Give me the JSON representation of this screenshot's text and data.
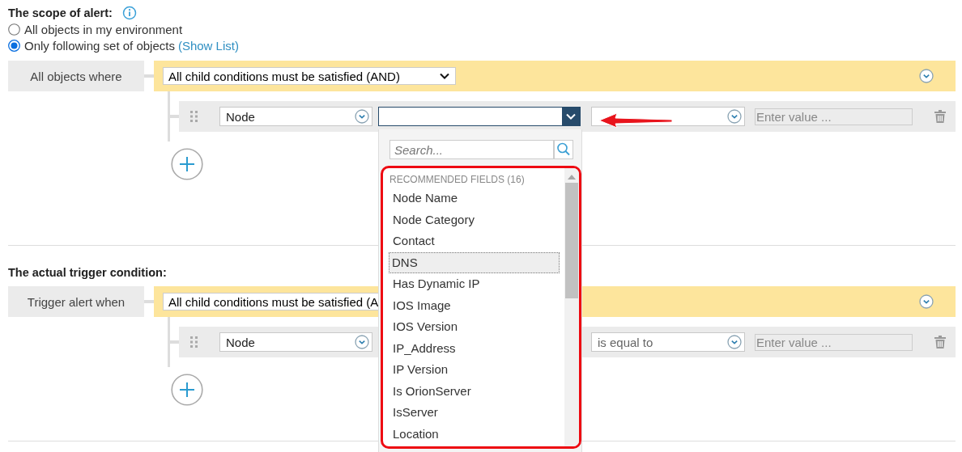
{
  "sections": [
    {
      "title": "The scope of alert:",
      "info": true,
      "options": [
        {
          "label": "All objects in my environment",
          "selected": false
        },
        {
          "label": "Only following set of objects",
          "link": "(Show List)",
          "selected": true
        }
      ],
      "block": {
        "label": "All objects where",
        "operator": "All child conditions must be satisfied (AND)",
        "caret": true,
        "collapse": true,
        "conditions": [
          {
            "object": "Node",
            "field": {
              "open": true
            },
            "value_placeholder": "Enter value ..."
          }
        ]
      }
    },
    {
      "title": "The actual trigger condition:",
      "info": false,
      "block": {
        "label": "Trigger alert when",
        "operator": "All child conditions must be satisfied (A",
        "caret": false,
        "collapse": true,
        "conditions": [
          {
            "object": "Node",
            "comparison": "is equal to",
            "value_placeholder": "Enter value ..."
          }
        ]
      }
    }
  ],
  "field_dropdown": {
    "search_placeholder": "Search...",
    "group": "RECOMMENDED FIELDS (16)",
    "items": [
      {
        "label": "Node Name",
        "selected": false
      },
      {
        "label": "Node Category",
        "selected": false
      },
      {
        "label": "Contact",
        "selected": false
      },
      {
        "label": "DNS",
        "selected": true
      },
      {
        "label": "Has Dynamic IP",
        "selected": false
      },
      {
        "label": "IOS Image",
        "selected": false
      },
      {
        "label": "IOS Version",
        "selected": false
      },
      {
        "label": "IP_Address",
        "selected": false
      },
      {
        "label": "IP Version",
        "selected": false
      },
      {
        "label": "Is OrionServer",
        "selected": false
      },
      {
        "label": "IsServer",
        "selected": false
      },
      {
        "label": "Location",
        "selected": false
      }
    ]
  }
}
